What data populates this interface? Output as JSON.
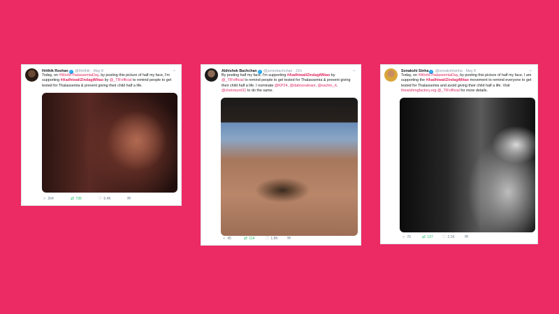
{
  "colors": {
    "background": "#ec2a63",
    "accent": "#e0245e",
    "retweet": "#17bf63"
  },
  "tweets": [
    {
      "author": "Hrithik Roshan",
      "handle": "@iHrithik",
      "time": "· May 8",
      "body": [
        {
          "t": "Today, on "
        },
        {
          "t": "#WorldThalassemiaDay",
          "s": "hl"
        },
        {
          "t": ", by posting this picture of half my face, I'm supporting "
        },
        {
          "t": "#AadhiwaliZindagiMitao",
          "s": "hlb"
        },
        {
          "t": " by "
        },
        {
          "t": "@_TIFofficial",
          "s": "hl"
        },
        {
          "t": " to remind people to get tested for Thalassemia & prevent giving their child half a life."
        }
      ],
      "replies": "204",
      "retweets": "736",
      "likes": "6.4K"
    },
    {
      "author": "Abhishek Bachchan",
      "handle": "@juniorbachchan",
      "time": "· 21h",
      "body": [
        {
          "t": "By posting half my face, I'm supporting "
        },
        {
          "t": "#AadhiwaliZindagiMitao",
          "s": "hlb"
        },
        {
          "t": " by "
        },
        {
          "t": "@_TIFofficial",
          "s": "hl"
        },
        {
          "t": " to remind people to get tested for Thalassemia & prevent giving their child half a life. I nominate "
        },
        {
          "t": "@KP24",
          "s": "hl"
        },
        {
          "t": ", "
        },
        {
          "t": "@dabooratnani",
          "s": "hl"
        },
        {
          "t": ", "
        },
        {
          "t": "@sachin_rt",
          "s": "hl"
        },
        {
          "t": ", "
        },
        {
          "t": "@chetrisunil11",
          "s": "hl"
        },
        {
          "t": " to do the same."
        }
      ],
      "replies": "45",
      "retweets": "114",
      "likes": "1.9K"
    },
    {
      "author": "Sonakshi Sinha",
      "handle": "@sonakshisinha",
      "time": "· May 8",
      "body": [
        {
          "t": "Today, on "
        },
        {
          "t": "#WorldThalassemiaDay",
          "s": "hl"
        },
        {
          "t": ", by posting this picture of half my face, I am supporting the "
        },
        {
          "t": "#AadhiwaliZindagiMitao",
          "s": "hlb"
        },
        {
          "t": " movement to remind everyone to get tested for Thalassemia and avoid giving their child half a life. Visit "
        },
        {
          "t": "thewishingfactory.org",
          "s": "hl"
        },
        {
          "t": " "
        },
        {
          "t": "@_TIFofficial",
          "s": "hl"
        },
        {
          "t": " for more details."
        }
      ],
      "replies": "70",
      "retweets": "137",
      "likes": "2.1K"
    }
  ]
}
